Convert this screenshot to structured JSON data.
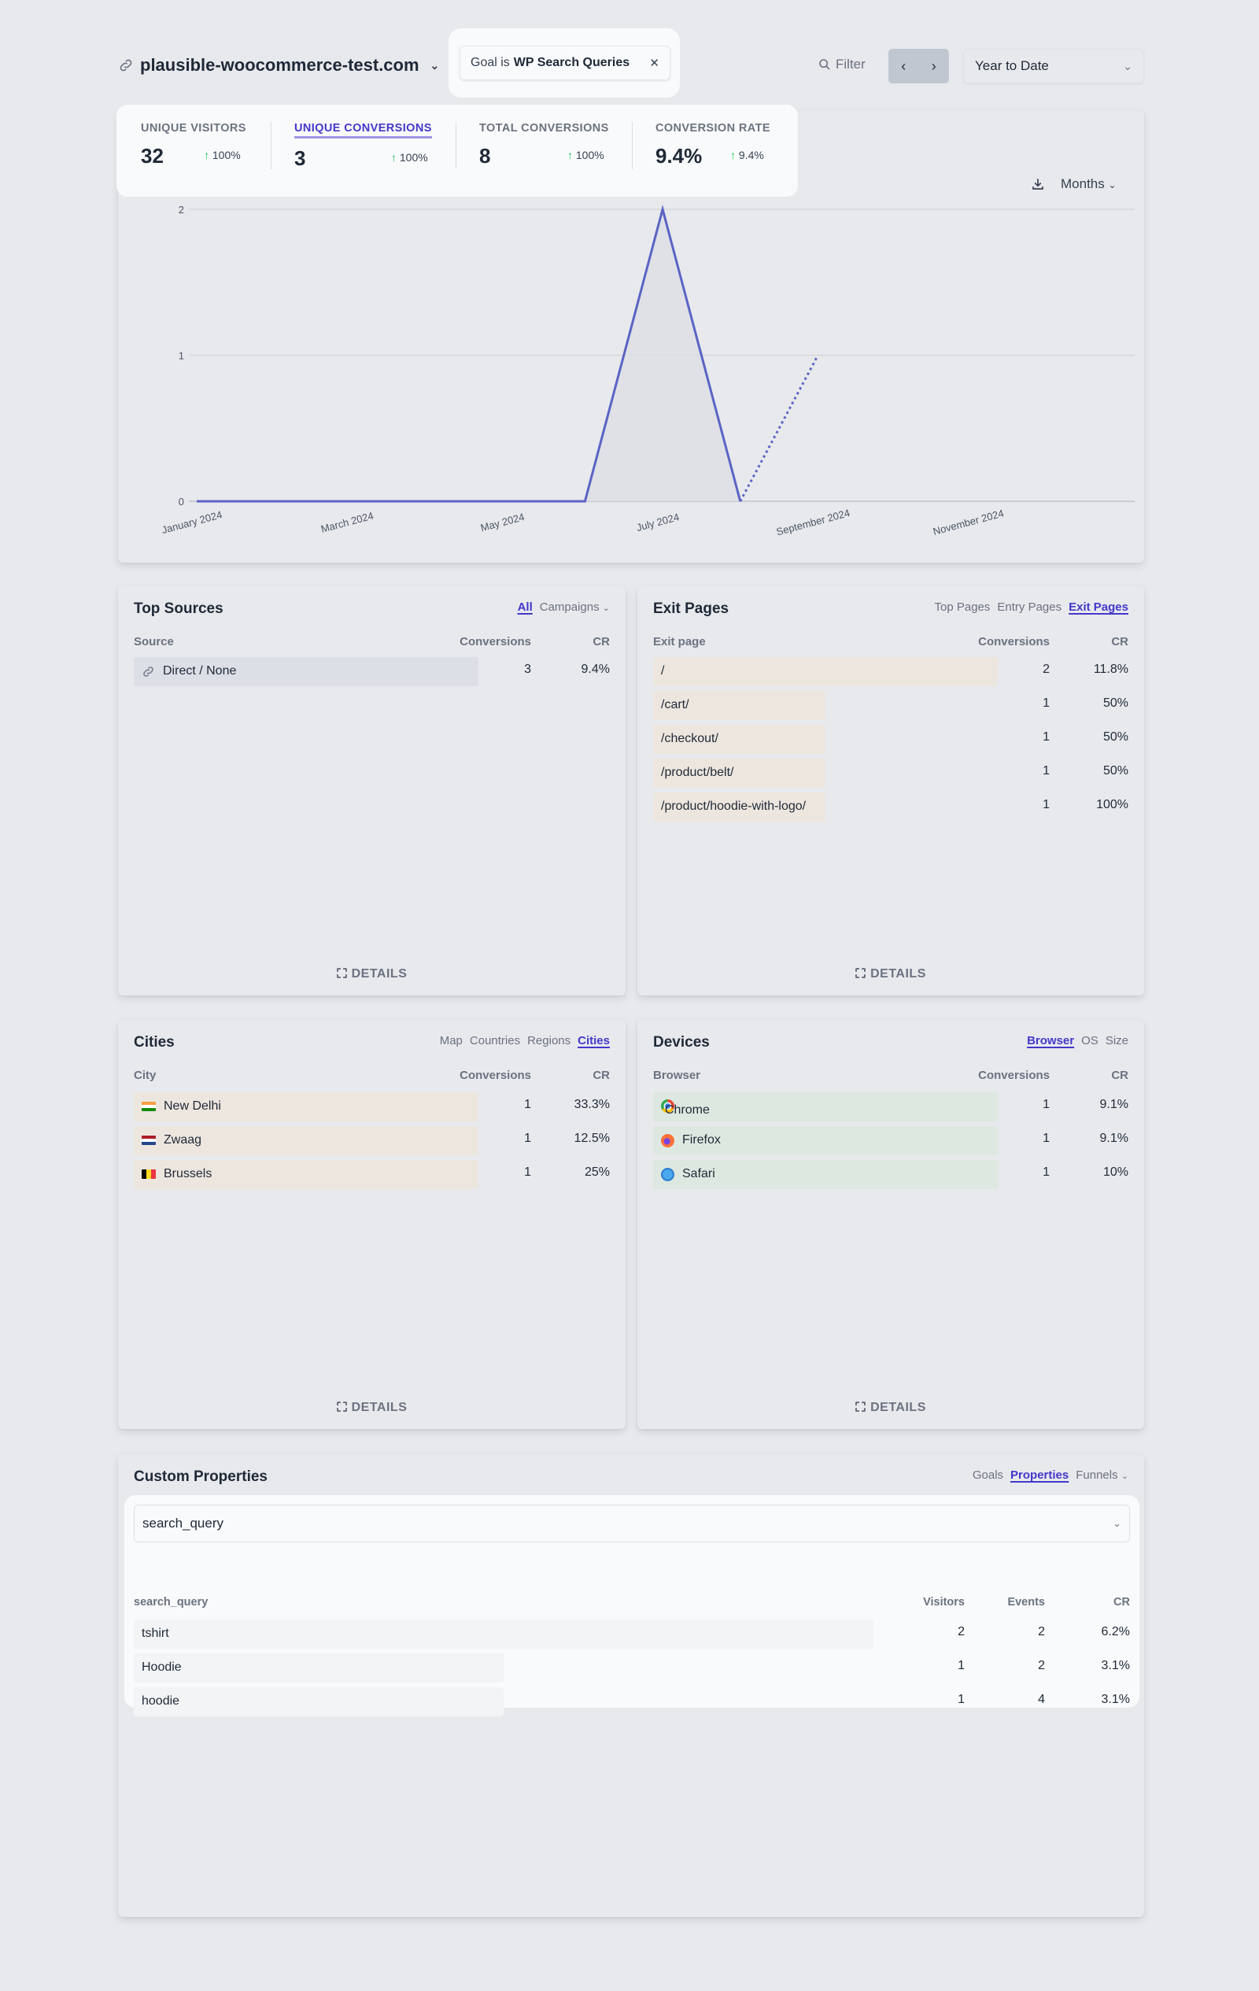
{
  "header": {
    "site_name": "plausible-woocommerce-test.com",
    "filter_prefix": "Goal is",
    "filter_value": "WP Search Queries",
    "filter_label": "Filter",
    "period": "Year to Date"
  },
  "stats": [
    {
      "label": "UNIQUE VISITORS",
      "value": "32",
      "change": "100%",
      "active": false
    },
    {
      "label": "UNIQUE CONVERSIONS",
      "value": "3",
      "change": "100%",
      "active": true
    },
    {
      "label": "TOTAL CONVERSIONS",
      "value": "8",
      "change": "100%",
      "active": false
    },
    {
      "label": "CONVERSION RATE",
      "value": "9.4%",
      "change": "9.4%",
      "active": false
    }
  ],
  "graph": {
    "interval": "Months"
  },
  "chart_data": {
    "type": "line",
    "title": "",
    "xlabel": "",
    "ylabel": "",
    "x": [
      "January 2024",
      "February 2024",
      "March 2024",
      "April 2024",
      "May 2024",
      "June 2024",
      "July 2024",
      "August 2024",
      "September 2024"
    ],
    "tick_labels": [
      "January 2024",
      "March 2024",
      "May 2024",
      "July 2024",
      "September 2024",
      "November 2024"
    ],
    "x_range": [
      "January 2024",
      "December 2024"
    ],
    "series": [
      {
        "name": "Unique conversions",
        "values": [
          0,
          0,
          0,
          0,
          0,
          0,
          2,
          0,
          1
        ],
        "incomplete_from_index": 7,
        "color": "#5b64c4"
      }
    ],
    "yticks": [
      0,
      1,
      2
    ],
    "ylim": [
      0,
      2
    ],
    "grid": true
  },
  "top_sources": {
    "title": "Top Sources",
    "tabs": [
      "All",
      "Campaigns"
    ],
    "active_tab": "All",
    "columns": [
      "Source",
      "Conversions",
      "CR"
    ],
    "rows": [
      {
        "name": "Direct / None",
        "conversions": "3",
        "cr": "9.4%",
        "share": 1.0
      }
    ],
    "details": "DETAILS"
  },
  "pages": {
    "title": "Exit Pages",
    "tabs": [
      "Top Pages",
      "Entry Pages",
      "Exit Pages"
    ],
    "active_tab": "Exit Pages",
    "columns": [
      "Exit page",
      "Conversions",
      "CR"
    ],
    "rows": [
      {
        "name": "/",
        "conversions": "2",
        "cr": "11.8%",
        "share": 1.0
      },
      {
        "name": "/cart/",
        "conversions": "1",
        "cr": "50%",
        "share": 0.5
      },
      {
        "name": "/checkout/",
        "conversions": "1",
        "cr": "50%",
        "share": 0.5
      },
      {
        "name": "/product/belt/",
        "conversions": "1",
        "cr": "50%",
        "share": 0.5
      },
      {
        "name": "/product/hoodie-with-logo/",
        "conversions": "1",
        "cr": "100%",
        "share": 0.5
      }
    ],
    "details": "DETAILS"
  },
  "locations": {
    "title": "Cities",
    "tabs": [
      "Map",
      "Countries",
      "Regions",
      "Cities"
    ],
    "active_tab": "Cities",
    "columns": [
      "City",
      "Conversions",
      "CR"
    ],
    "rows": [
      {
        "name": "New Delhi",
        "flag": "india-flag-icon",
        "conversions": "1",
        "cr": "33.3%",
        "share": 1.0
      },
      {
        "name": "Zwaag",
        "flag": "netherlands-flag-icon",
        "conversions": "1",
        "cr": "12.5%",
        "share": 1.0
      },
      {
        "name": "Brussels",
        "flag": "belgium-flag-icon",
        "conversions": "1",
        "cr": "25%",
        "share": 1.0
      }
    ],
    "details": "DETAILS"
  },
  "devices": {
    "title": "Devices",
    "tabs": [
      "Browser",
      "OS",
      "Size"
    ],
    "active_tab": "Browser",
    "columns": [
      "Browser",
      "Conversions",
      "CR"
    ],
    "rows": [
      {
        "name": "Chrome",
        "icon": "chrome-icon",
        "conversions": "1",
        "cr": "9.1%",
        "share": 1.0
      },
      {
        "name": "Firefox",
        "icon": "firefox-icon",
        "conversions": "1",
        "cr": "9.1%",
        "share": 1.0
      },
      {
        "name": "Safari",
        "icon": "safari-icon",
        "conversions": "1",
        "cr": "10%",
        "share": 1.0
      }
    ],
    "details": "DETAILS"
  },
  "custom_props": {
    "title": "Custom Properties",
    "tabs": [
      "Goals",
      "Properties",
      "Funnels"
    ],
    "active_tab": "Properties",
    "selected_property": "search_query",
    "columns": [
      "search_query",
      "Visitors",
      "Events",
      "CR"
    ],
    "rows": [
      {
        "name": "tshirt",
        "visitors": "2",
        "events": "2",
        "cr": "6.2%",
        "share": 1.0
      },
      {
        "name": "Hoodie",
        "visitors": "1",
        "events": "2",
        "cr": "3.1%",
        "share": 0.5
      },
      {
        "name": "hoodie",
        "visitors": "1",
        "events": "4",
        "cr": "3.1%",
        "share": 0.5
      }
    ]
  }
}
